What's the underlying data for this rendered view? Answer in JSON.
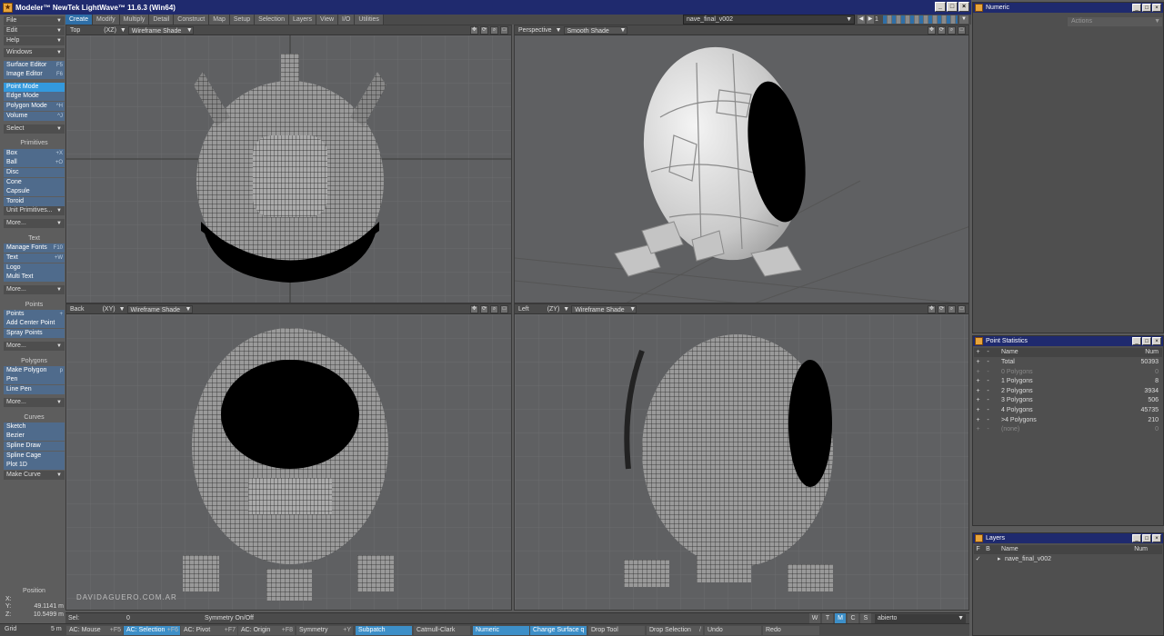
{
  "window": {
    "title": "Modeler™ NewTek LightWave™ 11.6.3 (Win64)",
    "logo_glyph": "★",
    "btn_min": "_",
    "btn_max": "□",
    "btn_close": "×"
  },
  "tabs": [
    "Create",
    "Modify",
    "Multiply",
    "Detail",
    "Construct",
    "Map",
    "Setup",
    "Selection",
    "Layers",
    "View",
    "I/O",
    "Utilities"
  ],
  "active_tab": "Create",
  "object_selector": {
    "value": "nave_final_v002",
    "layer_num": "1"
  },
  "numeric_panel": {
    "title": "Numeric",
    "actions_label": "Actions"
  },
  "sidebar": {
    "file": "File",
    "edit": "Edit",
    "help": "Help",
    "windows": "Windows",
    "surface_editor": "Surface Editor",
    "surface_editor_key": "F5",
    "image_editor": "Image Editor",
    "image_editor_key": "F6",
    "point_mode": "Point Mode",
    "edge_mode": "Edge Mode",
    "polygon_mode": "Polygon Mode",
    "polygon_mode_key": "^H",
    "volume": "Volume",
    "volume_key": "^J",
    "select": "Select",
    "primitives_header": "Primitives",
    "box": "Box",
    "box_key": "+X",
    "ball": "Ball",
    "ball_key": "+O",
    "disc": "Disc",
    "cone": "Cone",
    "capsule": "Capsule",
    "toroid": "Toroid",
    "unit_primitives": "Unit Primitives...",
    "more1": "More...",
    "text_header": "Text",
    "manage_fonts": "Manage Fonts",
    "manage_fonts_key": "F10",
    "text": "Text",
    "text_key": "+W",
    "logo": "Logo",
    "multi_text": "Multi Text",
    "more2": "More...",
    "points_header": "Points",
    "points": "Points",
    "points_key": "+",
    "add_center_point": "Add Center Point",
    "spray_points": "Spray Points",
    "more3": "More...",
    "polygons_header": "Polygons",
    "make_polygon": "Make Polygon",
    "make_polygon_key": "p",
    "pen": "Pen",
    "line_pen": "Line Pen",
    "more4": "More...",
    "curves_header": "Curves",
    "sketch": "Sketch",
    "bezier": "Bezier",
    "spline_draw": "Spline Draw",
    "spline_cage": "Spline Cage",
    "plot_1d": "Plot 1D",
    "make_curve": "Make Curve",
    "position_header": "Position",
    "pos_x_label": "X:",
    "pos_y_label": "Y:",
    "pos_z_label": "Z:",
    "pos_y": "49.1141 m",
    "pos_z": "10.5499 m",
    "grid_label": "Grid",
    "grid_value": "5 m"
  },
  "viewports": {
    "top": {
      "view": "Top",
      "axes": "(XZ)",
      "shade": "Wireframe Shade"
    },
    "perspective": {
      "view": "Perspective",
      "shade": "Smooth Shade"
    },
    "back": {
      "view": "Back",
      "axes": "(XY)",
      "shade": "Wireframe Shade"
    },
    "left": {
      "view": "Left",
      "axes": "(ZY)",
      "shade": "Wireframe Shade"
    },
    "watermark": "DAVIDAGUERO.COM.AR"
  },
  "point_statistics": {
    "title": "Point Statistics",
    "col_name": "Name",
    "col_num": "Num",
    "rows": [
      {
        "name": "Total",
        "num": "50393"
      },
      {
        "name": "0 Polygons",
        "num": "0"
      },
      {
        "name": "1 Polygons",
        "num": "8"
      },
      {
        "name": "2 Polygons",
        "num": "3934"
      },
      {
        "name": "3 Polygons",
        "num": "506"
      },
      {
        "name": "4 Polygons",
        "num": "45735"
      },
      {
        "name": ">4 Polygons",
        "num": "210"
      },
      {
        "name": "(none)",
        "num": "0"
      }
    ]
  },
  "layers_panel": {
    "title": "Layers",
    "col_f": "F",
    "col_b": "B",
    "col_name": "Name",
    "col_num": "Num",
    "layer_name": "nave_final_v002"
  },
  "statusbar": {
    "sel_label": "Sel:",
    "sel_value": "0",
    "symmetry": "Symmetry On/Off",
    "w": "W",
    "t": "T",
    "m": "M",
    "c": "C",
    "s": "S",
    "surface": "abierto"
  },
  "bottombar": {
    "ac_mouse": "AC: Mouse",
    "ac_mouse_key": "+F5",
    "ac_selection": "AC: Selection",
    "ac_selection_key": "+F6",
    "ac_pivot": "AC: Pivot",
    "ac_pivot_key": "+F7",
    "ac_origin": "AC: Origin",
    "ac_origin_key": "+F8",
    "symmetry": "Symmetry",
    "symmetry_key": "+Y",
    "subpatch": "Subpatch",
    "catmull": "Catmull-Clark",
    "numeric": "Numeric",
    "change_surface": "Change Surface q",
    "drop_tool": "Drop Tool",
    "drop_selection": "Drop Selection",
    "drop_selection_key": "/",
    "undo": "Undo",
    "redo": "Redo"
  }
}
